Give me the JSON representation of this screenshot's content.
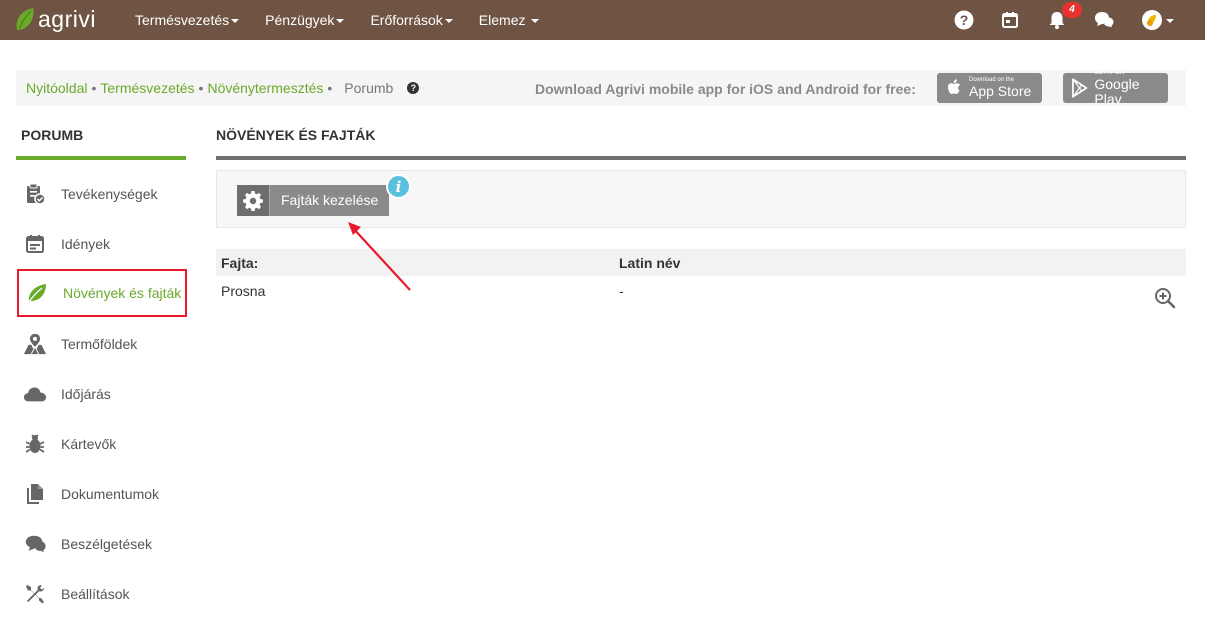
{
  "app": {
    "logo_text": "agrivi"
  },
  "nav": {
    "items": [
      {
        "label": "Termésvezetés"
      },
      {
        "label": "Pénzügyek"
      },
      {
        "label": "Erőforrások"
      },
      {
        "label": "Elemez"
      }
    ],
    "notification_count": "4"
  },
  "breadcrumb": {
    "links": [
      "Nyitóoldal",
      "Termésvezetés",
      "Növénytermesztés"
    ],
    "separator": "•",
    "current": "Porumb",
    "help": "?"
  },
  "download": {
    "text": "Download Agrivi mobile app for iOS and Android for free:",
    "appstore_small": "Download on the",
    "appstore_big": "App Store",
    "googleplay_small": "GET IT ON",
    "googleplay_big": "Google Play"
  },
  "sidebar": {
    "title": "PORUMB",
    "items": [
      {
        "label": "Tevékenységek",
        "icon": "clipboard-check-icon"
      },
      {
        "label": "Idények",
        "icon": "calendar-icon"
      },
      {
        "label": "Növények és fajták",
        "icon": "leaf-icon",
        "active": true
      },
      {
        "label": "Termőföldek",
        "icon": "field-pin-icon"
      },
      {
        "label": "Időjárás",
        "icon": "cloud-icon"
      },
      {
        "label": "Kártevők",
        "icon": "bug-icon"
      },
      {
        "label": "Dokumentumok",
        "icon": "documents-icon"
      },
      {
        "label": "Beszélgetések",
        "icon": "chat-icon"
      },
      {
        "label": "Beállítások",
        "icon": "tools-icon"
      }
    ]
  },
  "main": {
    "title": "NÖVÉNYEK ÉS FAJTÁK",
    "manage_button": "Fajták kezelése",
    "info": "i",
    "table": {
      "headers": [
        "Fajta:",
        "Latin név"
      ],
      "rows": [
        {
          "variety": "Prosna",
          "latin": "-"
        }
      ]
    }
  },
  "colors": {
    "topbar": "#6f5443",
    "accent_green": "#6aaa2b",
    "highlight_red": "#e8192c"
  }
}
